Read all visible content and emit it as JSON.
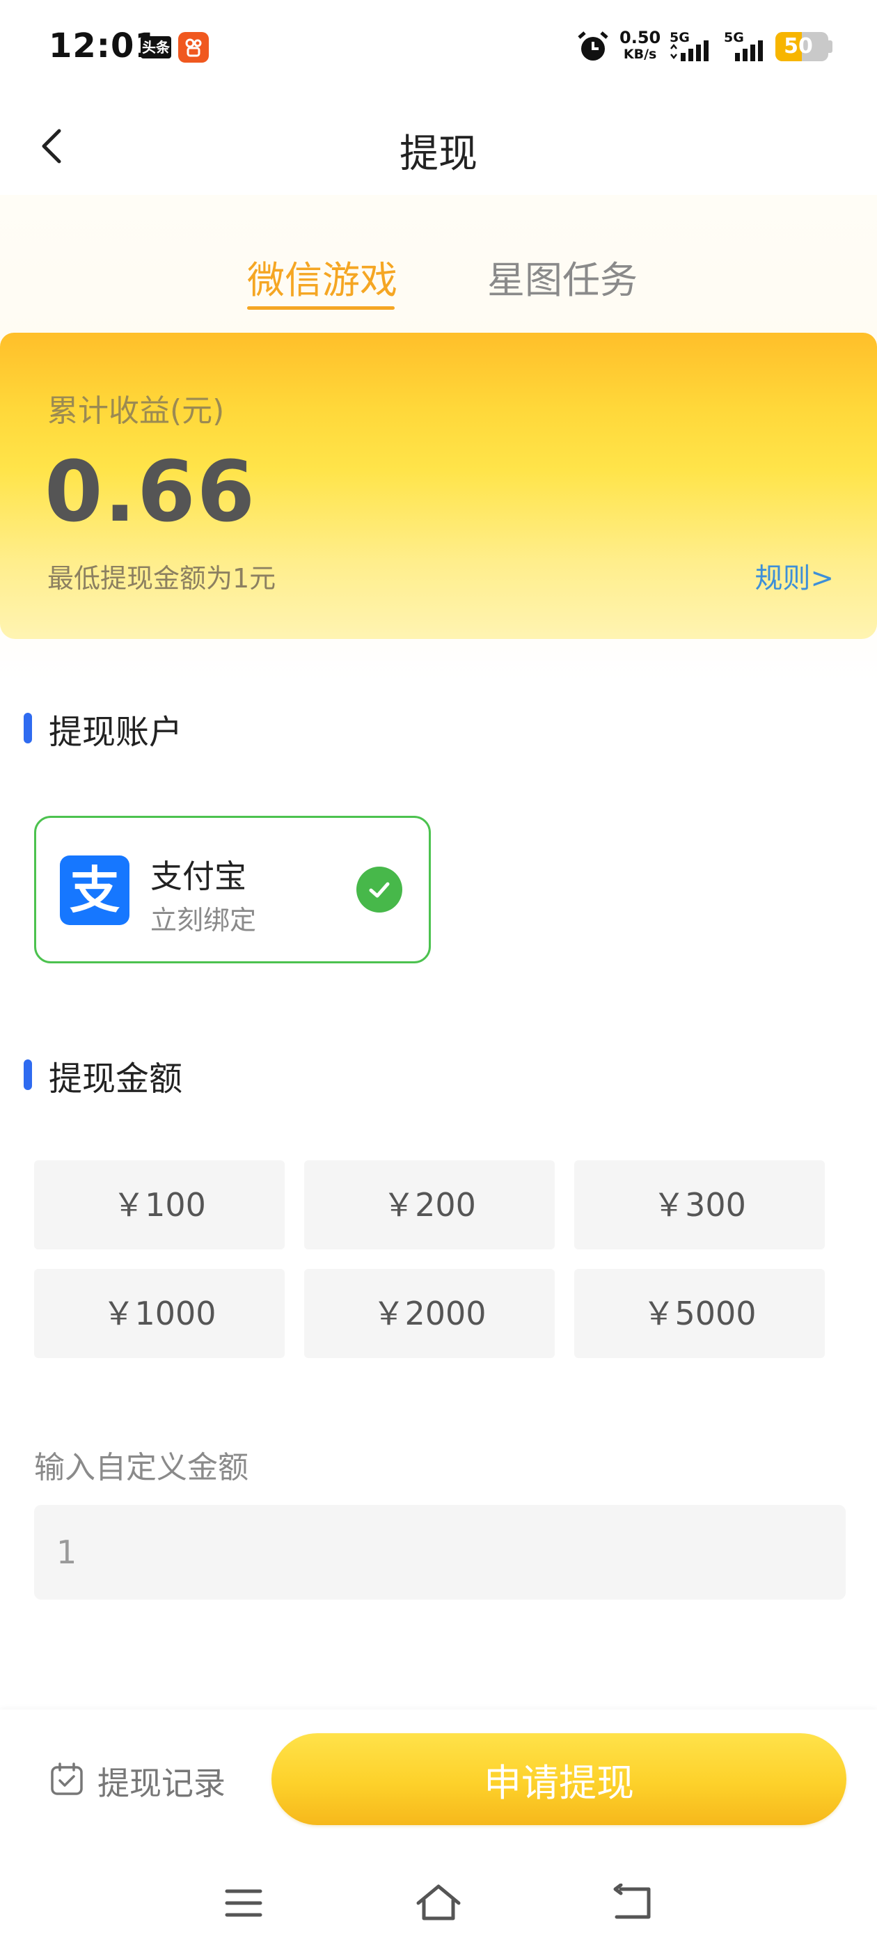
{
  "status_bar": {
    "time": "12:01",
    "app_badge_1": "头条",
    "net_speed_value": "0.50",
    "net_speed_unit": "KB/s",
    "signal_1_label": "5G",
    "signal_2_label": "5G",
    "battery_level": "50",
    "battery_fraction": 0.5
  },
  "header": {
    "title": "提现",
    "back_icon": "chevron-left-icon"
  },
  "tabs": [
    {
      "label": "微信游戏",
      "active": true
    },
    {
      "label": "星图任务",
      "active": false
    }
  ],
  "earnings": {
    "label": "累计收益(元)",
    "value": "0.66",
    "min_note": "最低提现金额为1元",
    "rules_link": "规则>"
  },
  "account_section": {
    "title": "提现账户",
    "account": {
      "name": "支付宝",
      "subtitle": "立刻绑定",
      "logo_glyph": "支",
      "selected": true
    }
  },
  "amount_section": {
    "title": "提现金额",
    "options": [
      "￥100",
      "￥200",
      "￥300",
      "￥1000",
      "￥2000",
      "￥5000"
    ],
    "custom_label": "输入自定义金额",
    "custom_placeholder": "1"
  },
  "bottom": {
    "records_label": "提现记录",
    "apply_label": "申请提现"
  },
  "colors": {
    "accent": "#f5a623",
    "link": "#3d8fd8",
    "section_bar": "#2f6bf0",
    "check_green": "#47b84a",
    "alipay_blue": "#1677ff"
  }
}
